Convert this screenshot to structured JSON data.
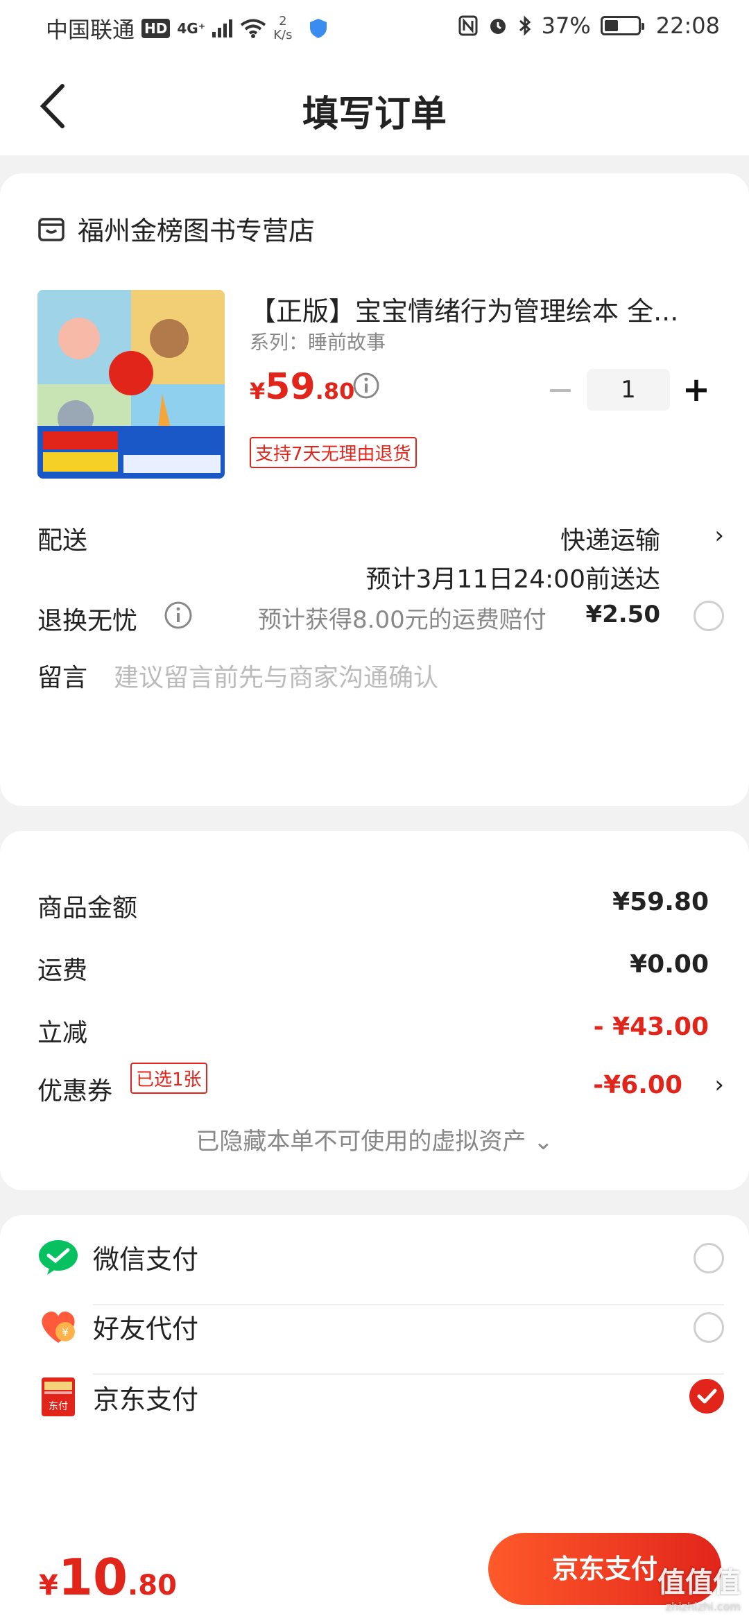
{
  "status_bar": {
    "carrier": "中国联通",
    "hd": "HD",
    "signal": "4G⁺",
    "net_speed_value": "2",
    "net_speed_unit": "K/s",
    "battery": "37%",
    "time": "22:08"
  },
  "nav": {
    "title": "填写订单"
  },
  "store": {
    "name": "福州金榜图书专营店",
    "product": {
      "title": "【正版】宝宝情绪行为管理绘本 全...",
      "series": "系列：睡前故事",
      "price_symbol": "¥",
      "price_int": "59",
      "price_dec": ".80",
      "quantity": "1",
      "minus": "−",
      "plus": "+",
      "return_tag": "支持7天无理由退货"
    },
    "delivery": {
      "label": "配送",
      "method": "快递运输",
      "eta": "预计3月11日24:00前送达"
    },
    "worry_free": {
      "label": "退换无忧",
      "text": "预计获得8.00元的运费赔付",
      "price": "¥2.50"
    },
    "note": {
      "label": "留言",
      "placeholder": "建议留言前先与商家沟通确认"
    }
  },
  "summary": {
    "goods_label": "商品金额",
    "goods_value": "¥59.80",
    "shipping_label": "运费",
    "shipping_value": "¥0.00",
    "discount_label": "立减",
    "discount_value": "- ¥43.00",
    "coupon_label": "优惠券",
    "coupon_tag": "已选1张",
    "coupon_value": "-¥6.00",
    "hidden_note": "已隐藏本单不可使用的虚拟资产 ⌄"
  },
  "payment": {
    "methods": [
      {
        "label": "微信支付",
        "icon": "wechat-pay-icon",
        "selected": false
      },
      {
        "label": "好友代付",
        "icon": "friend-pay-icon",
        "selected": false
      },
      {
        "label": "京东支付",
        "icon": "jd-pay-icon",
        "selected": true
      }
    ]
  },
  "bottom": {
    "total_symbol": "¥",
    "total_int": "10",
    "total_dec": ".80",
    "pay_button": "京东支付",
    "watermark": "值值值",
    "watermark_url": "zhizhizhi.com"
  },
  "colors": {
    "accent": "#e1251b",
    "wechat": "#07c160"
  }
}
